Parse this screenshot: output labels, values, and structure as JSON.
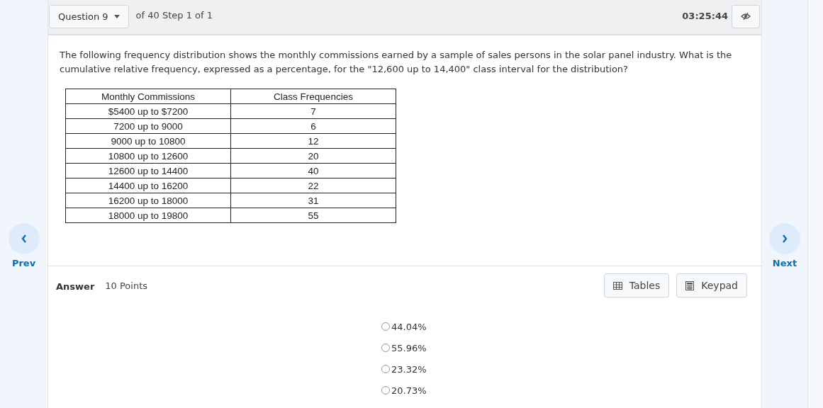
{
  "header": {
    "question_menu": "Question 9",
    "progress": "of 40 Step 1 of 1",
    "timer": "03:25:44"
  },
  "question": {
    "text": "The following frequency distribution shows the monthly commissions earned by a sample of sales persons in the solar panel industry.  What is the cumulative relative frequency, expressed as a percentage, for the \"12,600 up to 14,400\" class interval for the distribution?",
    "table": {
      "columns": [
        "Monthly Commissions",
        "Class Frequencies"
      ],
      "rows": [
        [
          "$5400  up to $7200",
          "7"
        ],
        [
          "7200  up to 9000",
          "6"
        ],
        [
          "9000  up to 10800",
          "12"
        ],
        [
          "10800  up to 12600",
          "20"
        ],
        [
          "12600  up to 14400",
          "40"
        ],
        [
          "14400  up to 16200",
          "22"
        ],
        [
          "16200  up to 18000",
          "31"
        ],
        [
          "18000  up to 19800",
          "55"
        ]
      ]
    }
  },
  "nav": {
    "prev": "Prev",
    "next": "Next"
  },
  "answer": {
    "label": "Answer",
    "points": "10 Points",
    "tools": [
      "Tables",
      "Keypad"
    ],
    "options": [
      {
        "text": "44.04%",
        "selected": false
      },
      {
        "text": "55.96%",
        "selected": false
      },
      {
        "text": "23.32%",
        "selected": false
      },
      {
        "text": "20.73%",
        "selected": false
      }
    ]
  }
}
